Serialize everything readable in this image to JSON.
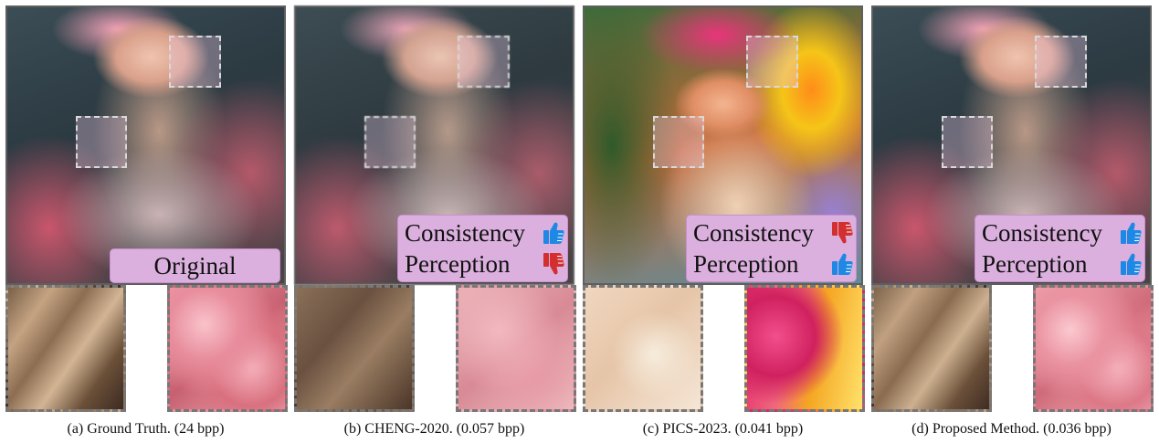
{
  "panels": [
    {
      "caption": "(a) Ground Truth. (24 bpp)",
      "badge": "Original"
    },
    {
      "caption": "(b) CHENG-2020. (0.057 bpp)",
      "consistency": {
        "label": "Consistency",
        "verdict": "thumbs-up"
      },
      "perception": {
        "label": "Perception",
        "verdict": "thumbs-down"
      }
    },
    {
      "caption": "(c) PICS-2023. (0.041 bpp)",
      "consistency": {
        "label": "Consistency",
        "verdict": "thumbs-down"
      },
      "perception": {
        "label": "Perception",
        "verdict": "thumbs-up"
      }
    },
    {
      "caption": "(d) Proposed Method. (0.036 bpp)",
      "consistency": {
        "label": "Consistency",
        "verdict": "thumbs-up"
      },
      "perception": {
        "label": "Perception",
        "verdict": "thumbs-up"
      }
    }
  ],
  "colors": {
    "badge_fill": "#dbb0de",
    "thumbs_up": "#1e88e5",
    "thumbs_down": "#d32f2f"
  }
}
